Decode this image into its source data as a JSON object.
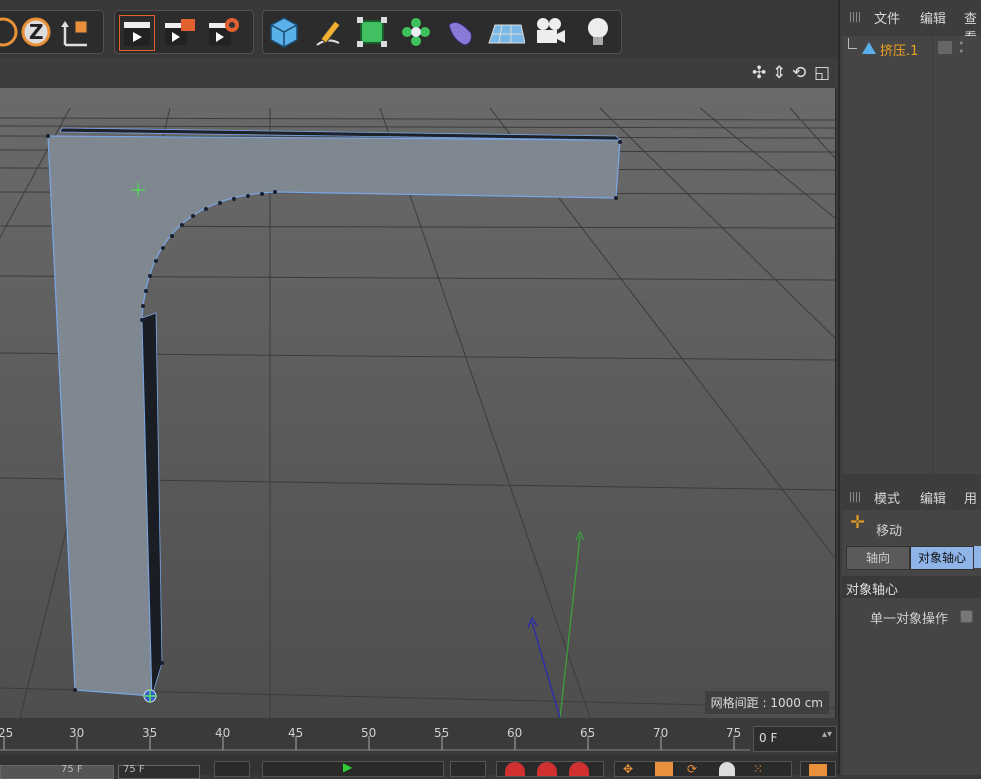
{
  "toolbar": {
    "icons": [
      "z-axis-lock-icon",
      "coordinate-system-icon",
      "render-view-icon",
      "render-picture-queue-icon",
      "render-settings-icon",
      "cube-primitive-icon",
      "pen-spline-icon",
      "subdivision-generator-icon",
      "cloner-icon",
      "deformer-icon",
      "floor-icon",
      "camera-icon",
      "light-icon"
    ],
    "z_label": "Z"
  },
  "viewport": {
    "grid_spacing_label": "网格间距 : 1000 cm"
  },
  "timeline": {
    "ticks": [
      "25",
      "30",
      "35",
      "40",
      "45",
      "50",
      "55",
      "60",
      "65",
      "70",
      "75"
    ],
    "current_frame": "0 F",
    "range_start": "75 F",
    "range_end": "75 F"
  },
  "object_manager": {
    "menu": [
      "文件",
      "编辑",
      "查看"
    ],
    "object_name": "挤压.1"
  },
  "attributes": {
    "menu": [
      "模式",
      "编辑",
      "用户"
    ],
    "tool_name": "移动",
    "tabs": [
      "轴向",
      "对象轴心"
    ],
    "section_title": "对象轴心",
    "option_label": "单一对象操作"
  },
  "colors": {
    "selection_orange": "#f0a020",
    "accent_blue": "#7aa6e6",
    "selected_tab": "#8fb4e8"
  }
}
